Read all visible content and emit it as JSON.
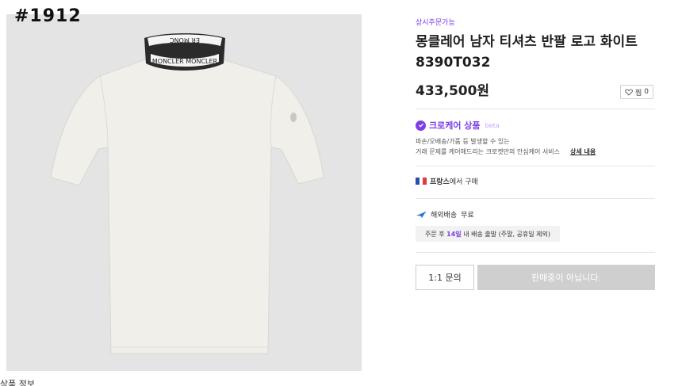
{
  "overlay": {
    "id_tag": "#1912"
  },
  "product": {
    "badge": "상시주문가능",
    "title": "몽클레어 남자 티셔츠 반팔 로고 화이트 8390T032",
    "price": "433,500원",
    "wish": {
      "label": "찜",
      "count": "0"
    },
    "collar_text_top": "ER MONC",
    "collar_text_front": "MONCLER MONCLER"
  },
  "crocare": {
    "title": "크로케어 상품",
    "beta": "beta",
    "desc_line1": "파손/오배송/가품 등 발생할 수 있는",
    "desc_line2": "거래 문제를 케어해드리는 크로켓만의 안심케어 서비스",
    "detail_link": "상세 내용"
  },
  "origin": {
    "country": "프랑스",
    "suffix": "에서 구매"
  },
  "shipping": {
    "label": "해외배송",
    "fee": "무료",
    "note_prefix": "주문 후",
    "note_days": "14일",
    "note_suffix": "내 배송 출발 (주말, 공휴일 제외)"
  },
  "actions": {
    "inquiry": "1:1 문의",
    "buy": "판매중이 아닙니다."
  },
  "footer": {
    "cut_text": "상품 정보"
  },
  "colors": {
    "accent": "#7b3fe4",
    "disabled_button": "#cfcfcf",
    "photo_bg": "#e4e4e4"
  }
}
